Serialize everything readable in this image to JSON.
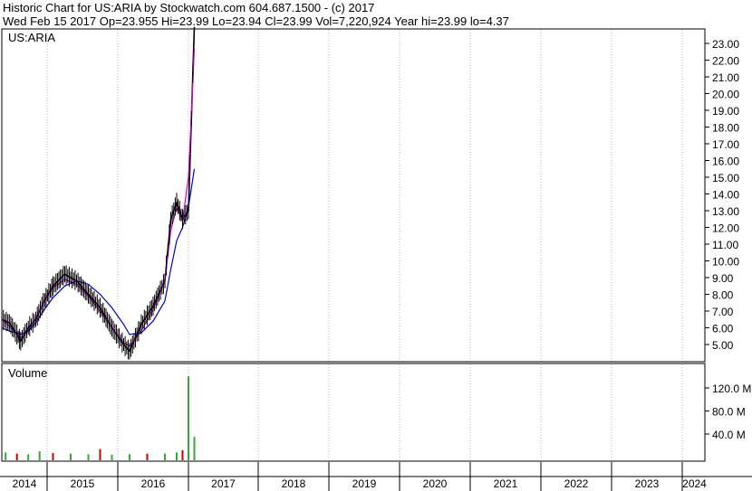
{
  "header": {
    "line1": "Historic Chart for US:ARIA by Stockwatch.com 604.687.1500 - (c) 2017",
    "line2": "Wed Feb 15 2017   Op=23.955  Hi=23.99  Lo=23.94  Cl=23.99  Vol=7,220,924  Year hi=23.99  lo=4.37"
  },
  "chart_data": [
    {
      "type": "line",
      "title": "US:ARIA",
      "ylim": [
        4.37,
        23.99
      ],
      "y_ticks": [
        "23.00",
        "22.00",
        "21.00",
        "20.00",
        "19.00",
        "18.00",
        "17.00",
        "16.00",
        "15.00",
        "14.00",
        "13.00",
        "12.00",
        "11.00",
        "10.00",
        "9.00",
        "8.00",
        "7.00",
        "6.00",
        "5.00"
      ],
      "x_ticks": [
        "2014",
        "2015",
        "2016",
        "2017",
        "2018",
        "2019",
        "2020",
        "2021",
        "2022",
        "2023",
        "2024"
      ],
      "grid": true,
      "colors": {
        "price": "#000000",
        "fast_ma": "#cc00cc",
        "slow_ma": "#0000cc"
      },
      "x": [
        "2014-01",
        "2014-03",
        "2014-05",
        "2014-06",
        "2014-08",
        "2014-10",
        "2014-12",
        "2015-02",
        "2015-04",
        "2015-06",
        "2015-08",
        "2015-10",
        "2015-12",
        "2016-02",
        "2016-03",
        "2016-05",
        "2016-07",
        "2016-09",
        "2016-10",
        "2016-11",
        "2016-12",
        "2017-01",
        "2017-02"
      ],
      "series": [
        {
          "values": [
            6.5,
            6.3,
            5.6,
            5.2,
            6.0,
            6.5,
            7.5,
            8.5,
            9.2,
            8.8,
            8.0,
            7.2,
            6.0,
            5.0,
            4.6,
            6.2,
            7.3,
            8.8,
            12.5,
            13.5,
            12.5,
            13.0,
            23.99
          ]
        },
        {
          "values": [
            6.5,
            6.1,
            5.6,
            5.4,
            5.8,
            6.6,
            7.5,
            8.4,
            8.9,
            8.6,
            7.9,
            7.0,
            6.0,
            5.1,
            4.9,
            5.8,
            7.1,
            8.8,
            11.8,
            13.2,
            12.4,
            15.0,
            22.7
          ]
        },
        {
          "values": [
            6.0,
            5.8,
            5.7,
            5.6,
            5.8,
            6.3,
            7.0,
            7.8,
            8.5,
            8.8,
            8.6,
            8.0,
            7.2,
            6.2,
            5.6,
            5.7,
            6.4,
            7.6,
            9.5,
            11.2,
            12.0,
            13.2,
            15.5
          ]
        }
      ]
    },
    {
      "type": "bar",
      "title": "Volume",
      "ylim": [
        0,
        140
      ],
      "y_ticks": [
        "120.0 M",
        "80.0 M",
        "40.0 M"
      ],
      "colors": {
        "up": "#33aa33",
        "down": "#cc0000"
      },
      "x": [
        "2014-02",
        "2014-05",
        "2014-08",
        "2014-11",
        "2015-02",
        "2015-05",
        "2015-08",
        "2015-10",
        "2015-12",
        "2016-03",
        "2016-06",
        "2016-09",
        "2016-11",
        "2016-12",
        "2017-01",
        "2017-02"
      ],
      "values": [
        8,
        6,
        5,
        10,
        7,
        6,
        5,
        14,
        4,
        5,
        6,
        6,
        8,
        12,
        140,
        35
      ]
    }
  ]
}
